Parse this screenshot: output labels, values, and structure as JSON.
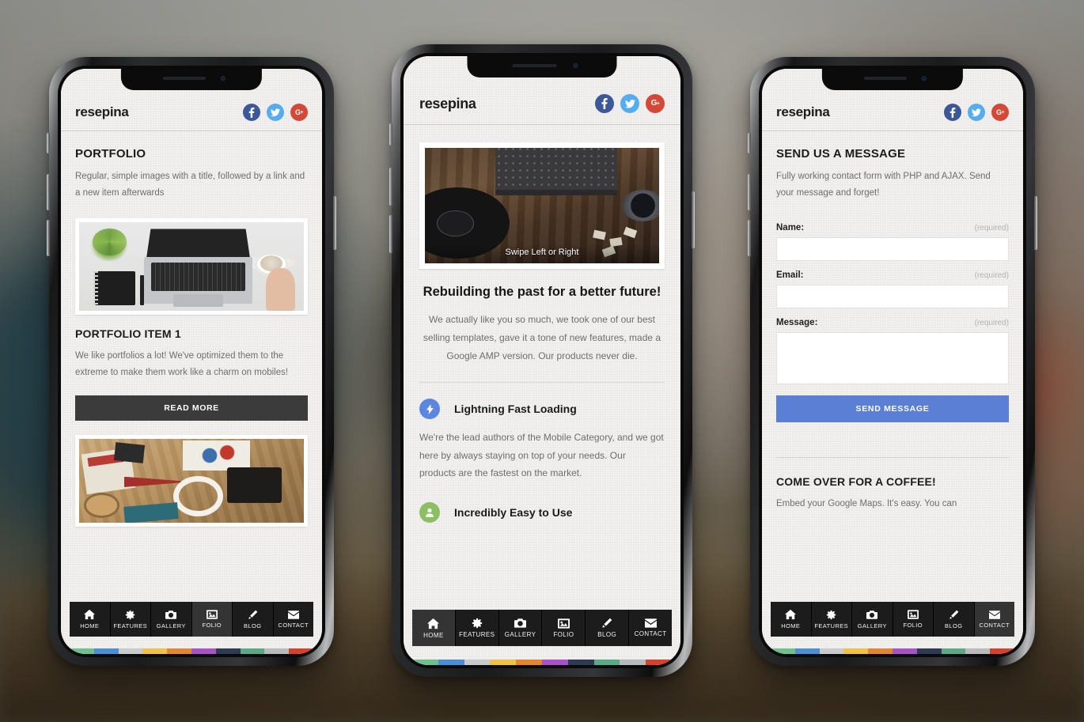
{
  "meta": {
    "brand": "resepina",
    "accent_blue": "#5b7fd4",
    "facebook_color": "#3b5998",
    "twitter_color": "#55acee",
    "googleplus_color": "#d34836",
    "nav_bg": "#1c1c1c",
    "nav_active_bg": "#343434",
    "dark_button": "#3b3b3b"
  },
  "social": [
    {
      "name": "facebook",
      "icon": "facebook-icon",
      "label": "f",
      "color": "#3b5998"
    },
    {
      "name": "twitter",
      "icon": "twitter-icon",
      "label": "t",
      "color": "#55acee"
    },
    {
      "name": "googleplus",
      "icon": "google-plus-icon",
      "label": "G+",
      "color": "#d34836"
    }
  ],
  "bottom_nav": {
    "items": [
      {
        "label": "HOME",
        "icon": "home-icon"
      },
      {
        "label": "FEATURES",
        "icon": "gear-icon"
      },
      {
        "label": "GALLERY",
        "icon": "camera-icon"
      },
      {
        "label": "FOLIO",
        "icon": "image-icon"
      },
      {
        "label": "BLOG",
        "icon": "pencil-icon"
      },
      {
        "label": "CONTACT",
        "icon": "envelope-icon"
      }
    ],
    "active_phone1": "FOLIO",
    "active_phone2": "HOME",
    "active_phone3": "CONTACT"
  },
  "color_strip": [
    "#6fbf8f",
    "#4a8fd4",
    "#c9cacb",
    "#f0c243",
    "#e3872f",
    "#a752c9",
    "#2e3a4f",
    "#5aa987",
    "#b9babb",
    "#d6412c"
  ],
  "phone1": {
    "section_title": "PORTFOLIO",
    "section_sub": "Regular, simple images with a title, followed by a link and a new item afterwards",
    "item_title": "PORTFOLIO ITEM 1",
    "item_body": "We like portfolios a lot! We've optimized them to the extreme to make them work like a charm on mobiles!",
    "read_more": "READ MORE",
    "image1_alt": "laptop-desk-photo",
    "image2_alt": "vintage-typography-desk-photo"
  },
  "phone2": {
    "slide_caption": "Swipe Left or Right",
    "slider_alt": "typewriter-vinyl-record-photo",
    "headline": "Rebuilding the past for a better future!",
    "body": "We actually like you so much, we took one of our best selling templates, gave it a tone of new features, made a Google AMP version. Our products never die.",
    "features": [
      {
        "title": "Lightning Fast Loading",
        "icon": "bolt-icon",
        "color": "#5b87e0",
        "body": "We're the lead authors of the Mobile Category, and we got here by always staying on top of your needs. Our products are the fastest on the market."
      },
      {
        "title": "Incredibly Easy to Use",
        "icon": "user-icon",
        "color": "#8cbf62",
        "body": ""
      }
    ]
  },
  "phone3": {
    "section_title": "SEND US A MESSAGE",
    "section_sub": "Fully working contact form with PHP and AJAX. Send your message and forget!",
    "fields": [
      {
        "label": "Name:",
        "required": "(required)",
        "value": "",
        "type": "text"
      },
      {
        "label": "Email:",
        "required": "(required)",
        "value": "",
        "type": "text"
      },
      {
        "label": "Message:",
        "required": "(required)",
        "value": "",
        "type": "textarea"
      }
    ],
    "send_button": "SEND MESSAGE",
    "map_title": "COME OVER FOR A COFFEE!",
    "map_sub": "Embed your Google Maps. It's easy. You can"
  }
}
